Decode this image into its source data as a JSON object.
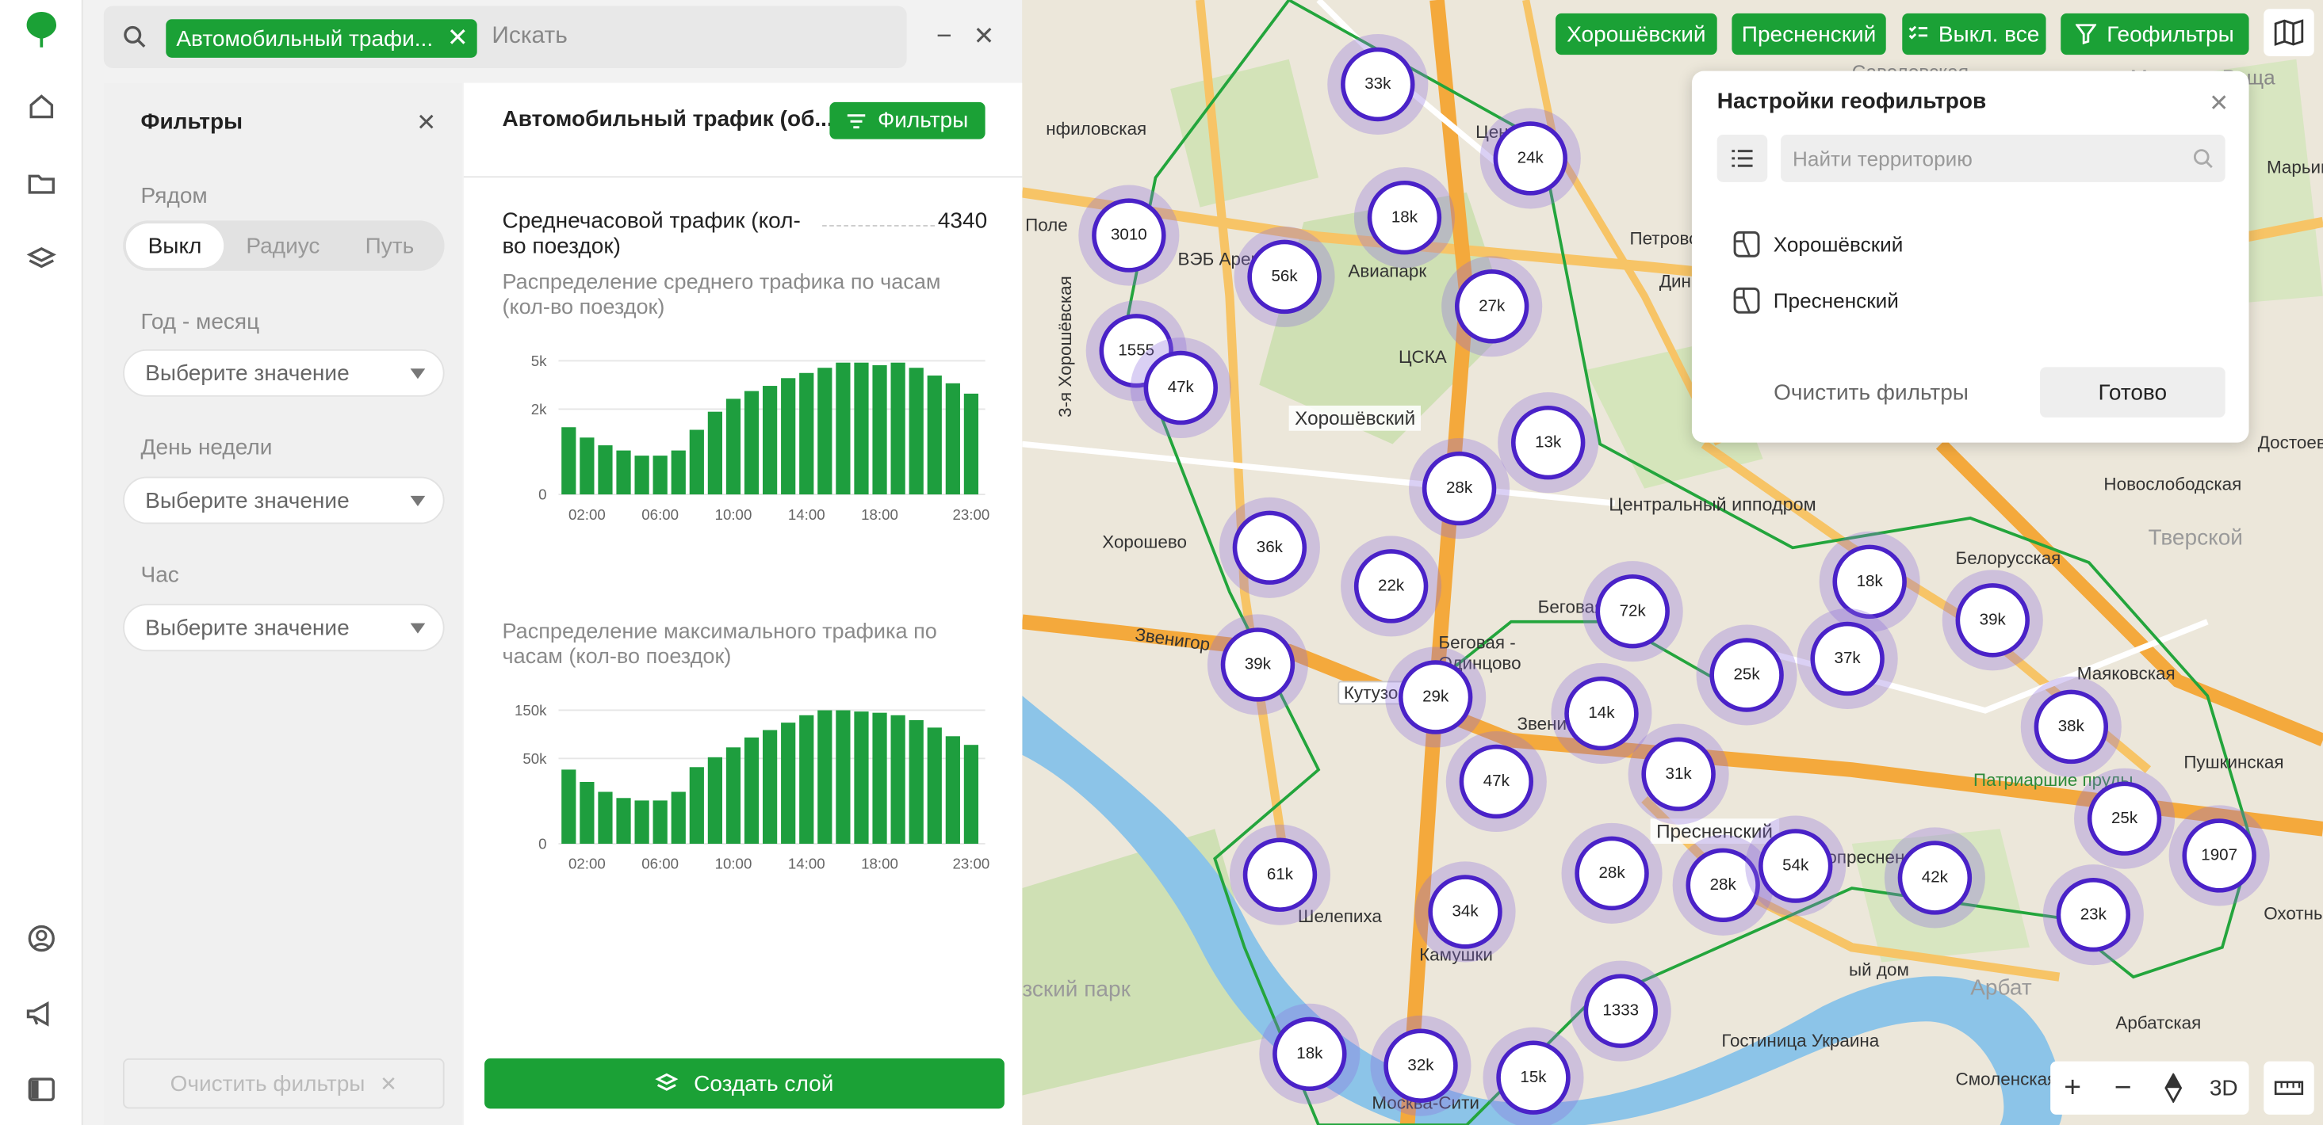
{
  "search": {
    "chip_label": "Автомобильный трафи...",
    "placeholder": "Искать"
  },
  "filters": {
    "title": "Фильтры",
    "nearby_label": "Рядом",
    "nearby_options": [
      "Выкл",
      "Радиус",
      "Путь"
    ],
    "nearby_selected": "Выкл",
    "year_month_label": "Год - месяц",
    "day_of_week_label": "День недели",
    "hour_label": "Час",
    "select_placeholder": "Выберите значение",
    "clear_label": "Очистить фильтры"
  },
  "panel": {
    "title": "Автомобильный трафик (об...",
    "filters_button": "Фильтры",
    "metric_label": "Среднечасовой трафик (кол-во поездок)",
    "metric_value": "4340",
    "create_layer": "Создать слой"
  },
  "chart_data": [
    {
      "type": "bar",
      "title": "Распределение среднего трафика по часам (кол-во поездок)",
      "x": [
        1,
        2,
        3,
        4,
        5,
        6,
        7,
        8,
        9,
        10,
        11,
        12,
        13,
        14,
        15,
        16,
        17,
        18,
        19,
        20,
        21,
        22,
        23
      ],
      "x_tick_labels": [
        "02:00",
        "06:00",
        "10:00",
        "14:00",
        "18:00",
        "23:00"
      ],
      "y_tick_labels": [
        "5k",
        "2k",
        "0"
      ],
      "values": [
        2.6,
        2.2,
        1.9,
        1.7,
        1.5,
        1.5,
        1.7,
        2.5,
        3.2,
        3.7,
        4.0,
        4.2,
        4.5,
        4.7,
        4.9,
        5.1,
        5.1,
        5.0,
        5.1,
        4.9,
        4.6,
        4.3,
        3.9
      ],
      "ylim": [
        0,
        5.5
      ],
      "unit": "k",
      "color": "#1e9e3e"
    },
    {
      "type": "bar",
      "title": "Распределение максимального трафика по часам (кол-во поездок)",
      "x": [
        1,
        2,
        3,
        4,
        5,
        6,
        7,
        8,
        9,
        10,
        11,
        12,
        13,
        14,
        15,
        16,
        17,
        18,
        19,
        20,
        21,
        22,
        23
      ],
      "x_tick_labels": [
        "02:00",
        "06:00",
        "10:00",
        "14:00",
        "18:00",
        "23:00"
      ],
      "y_tick_labels": [
        "150k",
        "50k",
        "0"
      ],
      "values": [
        60,
        50,
        42,
        37,
        35,
        35,
        42,
        62,
        70,
        78,
        86,
        92,
        98,
        104,
        108,
        108,
        107,
        106,
        104,
        100,
        94,
        87,
        80
      ],
      "ylim": [
        0,
        115
      ],
      "unit": "k",
      "color": "#1e9e3e"
    }
  ],
  "map": {
    "territory_buttons": [
      "Хорошёвский",
      "Пресненский"
    ],
    "disable_all": "Выкл. все",
    "geofilters_button": "Геофильтры",
    "clusters": [
      {
        "label": "33k"
      },
      {
        "label": "24k"
      },
      {
        "label": "18k"
      },
      {
        "label": "3010"
      },
      {
        "label": "56k"
      },
      {
        "label": "27k"
      },
      {
        "label": "1555"
      },
      {
        "label": "47k"
      },
      {
        "label": "13k"
      },
      {
        "label": "28k"
      },
      {
        "label": "36k"
      },
      {
        "label": "22k"
      },
      {
        "label": "72k"
      },
      {
        "label": "18k"
      },
      {
        "label": "39k"
      },
      {
        "label": "39k"
      },
      {
        "label": "29k"
      },
      {
        "label": "25k"
      },
      {
        "label": "37k"
      },
      {
        "label": "14k"
      },
      {
        "label": "31k"
      },
      {
        "label": "47k"
      },
      {
        "label": "38k"
      },
      {
        "label": "61k"
      },
      {
        "label": "34k"
      },
      {
        "label": "28k"
      },
      {
        "label": "28k"
      },
      {
        "label": "54k"
      },
      {
        "label": "42k"
      },
      {
        "label": "25k"
      },
      {
        "label": "1907"
      },
      {
        "label": "23k"
      },
      {
        "label": "1333"
      },
      {
        "label": "18k"
      },
      {
        "label": "32k"
      },
      {
        "label": "15k"
      }
    ],
    "labels": {
      "khoroshevsky": "Хорошёвский",
      "presnensky": "Пресненский",
      "avia": "Авиапарк",
      "cska": "ЦСКА",
      "ippodrom": "Центральный ипподром",
      "pole": "Поле",
      "veb": "ВЭБ Арен",
      "khoroshevskaya": "3-я Хорошёвская",
      "filyovskaya": "нфиловская",
      "petrovsky": "Петровский",
      "din": "Дин",
      "begovaya": "Беговая",
      "zvenigor": "Звенигор",
      "kutuzov": "Кутузов",
      "zvenig2": "Звени",
      "begovaya_odintsovo": "Беговая - Одинцово",
      "presnya": "краснопресненская",
      "shelepikha": "Шелепиха",
      "kamushki": "Камушки",
      "park": "зский парк",
      "moskva_city": "Москва-Сити",
      "gostinitsa": "Гостиница Украина",
      "smolenskaya": "Смоленская",
      "arbat": "Арбат",
      "arbatskaya": "Арбатская",
      "patriarshie": "Патриаршие пруды",
      "mayakovskaya": "Маяковская",
      "pushkinskaya": "Пушкинская",
      "tverskoy": "Тверской",
      "novoslobodskaya": "Новослободская",
      "dostoevskaya": "Достоевс",
      "marina": "Марьина Роща",
      "savelovskaya": "Савеловская",
      "belorusskaya": "Белорусская",
      "okhotny": "Охотны",
      "dom": "ый дом",
      "maryina2": "Марьин",
      "khoroshevo": "Хорошево",
      "ts": "Цен"
    },
    "zoom_controls": {
      "plus": "+",
      "minus": "−",
      "three_d": "3D"
    }
  },
  "geo_popup": {
    "title": "Настройки геофильтров",
    "search_placeholder": "Найти территорию",
    "items": [
      "Хорошёвский",
      "Пресненский"
    ],
    "clear": "Очистить фильтры",
    "done": "Готово"
  },
  "colors": {
    "accent": "#1ba136",
    "cluster_border": "#4a22c8",
    "bar": "#1e9e3e"
  }
}
